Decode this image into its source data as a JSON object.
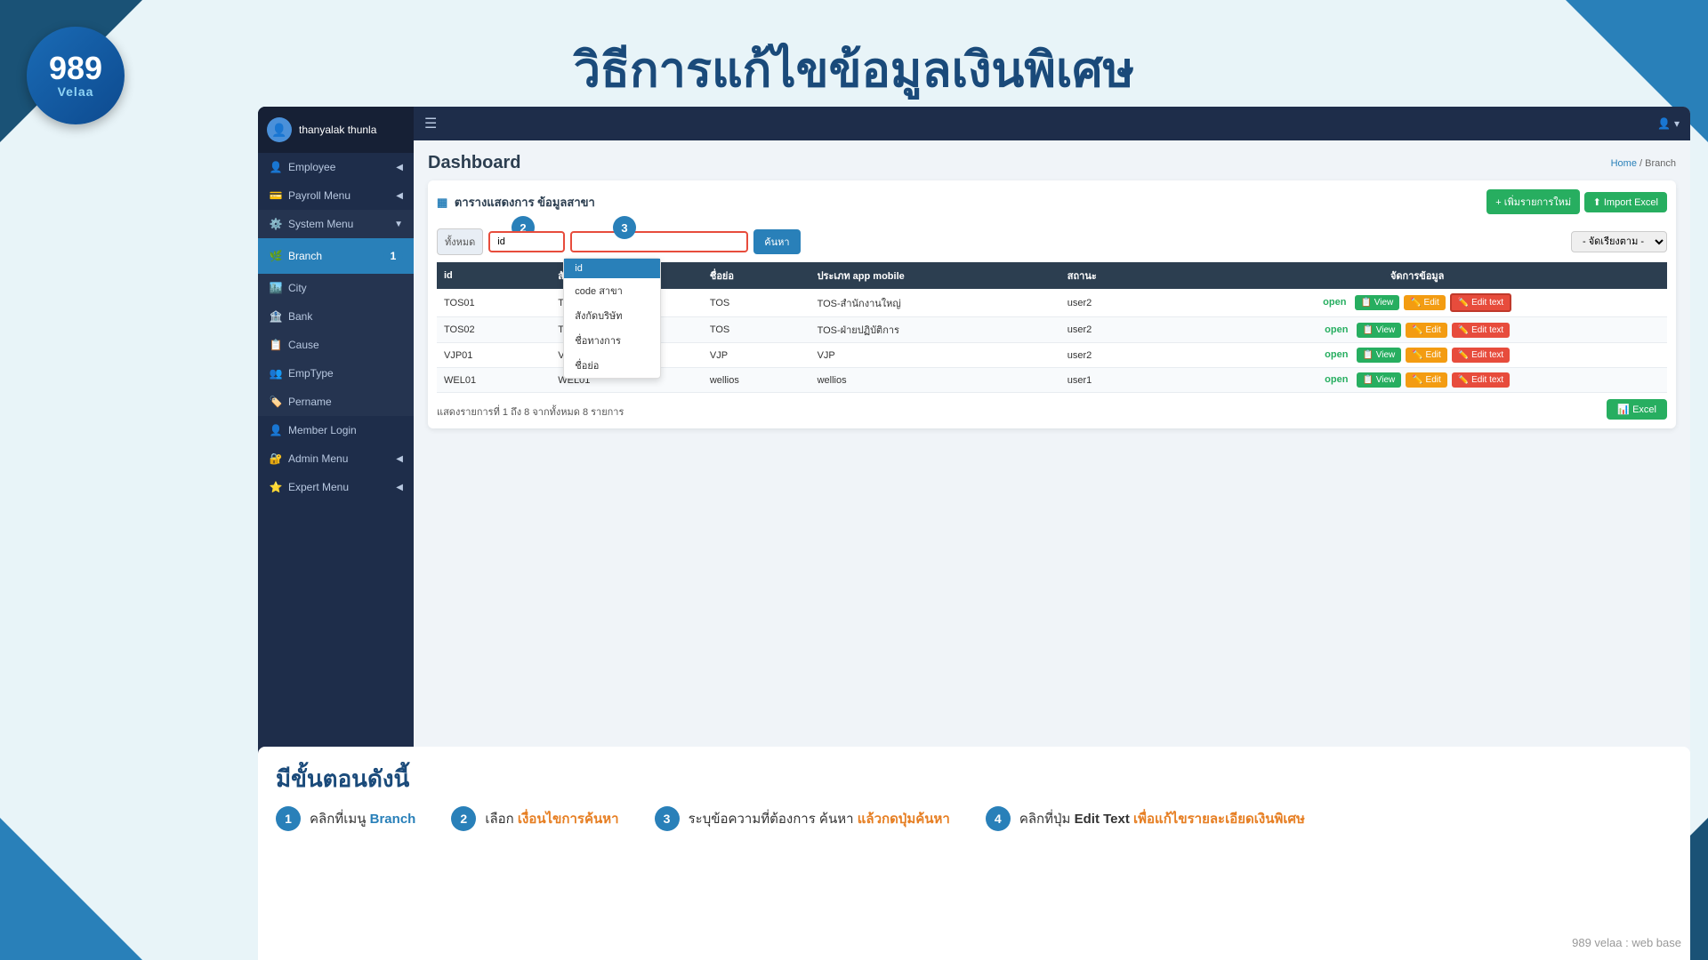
{
  "page": {
    "title": "วิธีการแก้ไขข้อมูลเงินพิเศษ",
    "footer_credit": "989 velaa : web base"
  },
  "logo": {
    "number": "989",
    "name": "Velaa"
  },
  "sidebar": {
    "user": "thanyalak thunla",
    "items": [
      {
        "id": "employee",
        "label": "Employee",
        "icon": "👤",
        "has_arrow": true
      },
      {
        "id": "payroll",
        "label": "Payroll Menu",
        "icon": "💳",
        "has_arrow": true
      },
      {
        "id": "system",
        "label": "System Menu",
        "icon": "⚙️",
        "has_arrow": true,
        "active_group": true
      },
      {
        "id": "branch",
        "label": "Branch",
        "icon": "🌿",
        "active": true,
        "step": 1
      },
      {
        "id": "city",
        "label": "City",
        "icon": "🏙️"
      },
      {
        "id": "bank",
        "label": "Bank",
        "icon": "🏦"
      },
      {
        "id": "cause",
        "label": "Cause",
        "icon": "📋"
      },
      {
        "id": "emptype",
        "label": "EmpType",
        "icon": "👥"
      },
      {
        "id": "pername",
        "label": "Pername",
        "icon": "🏷️"
      },
      {
        "id": "member",
        "label": "Member Login",
        "icon": "👤"
      },
      {
        "id": "admin",
        "label": "Admin Menu",
        "icon": "🔐",
        "has_arrow": true
      },
      {
        "id": "expert",
        "label": "Expert Menu",
        "icon": "⭐",
        "has_arrow": true
      }
    ]
  },
  "dashboard": {
    "title": "Dashboard",
    "breadcrumb_home": "Home",
    "breadcrumb_branch": "Branch"
  },
  "table": {
    "section_title": "ตารางแสดงการ ข้อมูลสาขา",
    "btn_add": "+ เพิ่มรายการใหม่",
    "btn_import": "⬆ Import Excel",
    "search_label": "ทั้งหมด",
    "search_options": [
      "id",
      "code สาขา",
      "สังกัดบริษัท",
      "ชื่อทางการ",
      "ชื่อย่อ"
    ],
    "search_placeholder": "",
    "btn_search": "ค้นหา",
    "sort_default": "- จัดเรียงตาม -",
    "columns": [
      "id",
      "สังกัดบริษัท",
      "ชื่อย่อ",
      "ประเภท app mobile",
      "สถานะ",
      "จัดการข้อมูล"
    ],
    "rows": [
      {
        "id": "TOS01",
        "company_code": "TOS01",
        "company": "TOS",
        "name": "TOS-สำนักงานใหญ่",
        "app_type": "user2",
        "status": "open"
      },
      {
        "id": "TOS02",
        "company_code": "TOS02",
        "company": "TOS",
        "name": "TOS-ฝ่ายปฏิบัติการ",
        "app_type": "user2",
        "status": "open"
      },
      {
        "id": "VJP01",
        "company_code": "VJP01",
        "company": "VJP",
        "name": "VJP",
        "app_type": "user2",
        "status": "open"
      },
      {
        "id": "WEL01",
        "company_code": "WEL01",
        "company": "wellios",
        "name": "wellios",
        "app_type": "user1",
        "status": "open"
      }
    ],
    "pagination": "แสดงรายการที่ 1 ถึง 8 จากทั้งหมด 8 รายการ",
    "btn_view": "📋 View",
    "btn_edit": "✏️ Edit",
    "btn_edittext": "✏️ Edit text"
  },
  "instructions": {
    "title": "มีขั้นตอนดังนี้",
    "steps": [
      {
        "num": 1,
        "text_plain": "คลิกที่เมนู ",
        "text_highlight": "Branch",
        "highlight_color": "blue"
      },
      {
        "num": 2,
        "text_plain": "เลือก ",
        "text_highlight": "เงื่อนไขการค้นหา",
        "highlight_color": "orange"
      },
      {
        "num": 3,
        "text_plain": "ระบุข้อความที่ต้องการ ค้นหา ",
        "text_highlight": "แล้วกดปุ่มค้นหา",
        "highlight_color": "orange"
      },
      {
        "num": 4,
        "text_plain": "คลิกที่ปุ่ม ",
        "text_highlight_bold": "Edit Text",
        "text_plain2": " เพื่อแก้ไขรายละเอียดเงินพิเศษ",
        "highlight_color": "orange"
      }
    ]
  },
  "topbar": {
    "user_icon": "👤",
    "user_arrow": "▾"
  }
}
